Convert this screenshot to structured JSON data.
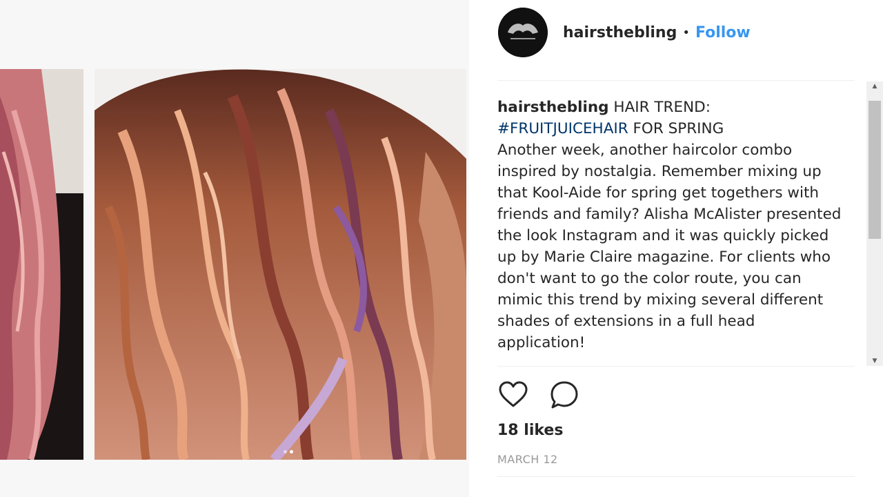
{
  "post": {
    "username": "hairsthebling",
    "separator": "•",
    "follow_label": "Follow",
    "caption": {
      "username": "hairsthebling",
      "title": "HAIR TREND:",
      "hashtag": "#FRUITJUICEHAIR",
      "title_suffix": " FOR SPRING",
      "body": "Another week, another haircolor combo inspired by nostalgia. Remember mixing up that Kool-Aide for spring get togethers with friends and family? Alisha McAlister presented the look Instagram and it was quickly picked up by Marie Claire magazine. For clients who don't want to go the color route, you can mimic this trend by mixing several different shades of extensions in a full head application!"
    },
    "likes": "18 likes",
    "date": "MARCH 12"
  },
  "carousel": {
    "total_slides": 2,
    "active_slide": 2
  },
  "icons": {
    "like": "heart-icon",
    "comment": "comment-icon"
  },
  "colors": {
    "follow": "#3897f0",
    "hashtag": "#003569",
    "text": "#262626",
    "muted": "#999999"
  }
}
